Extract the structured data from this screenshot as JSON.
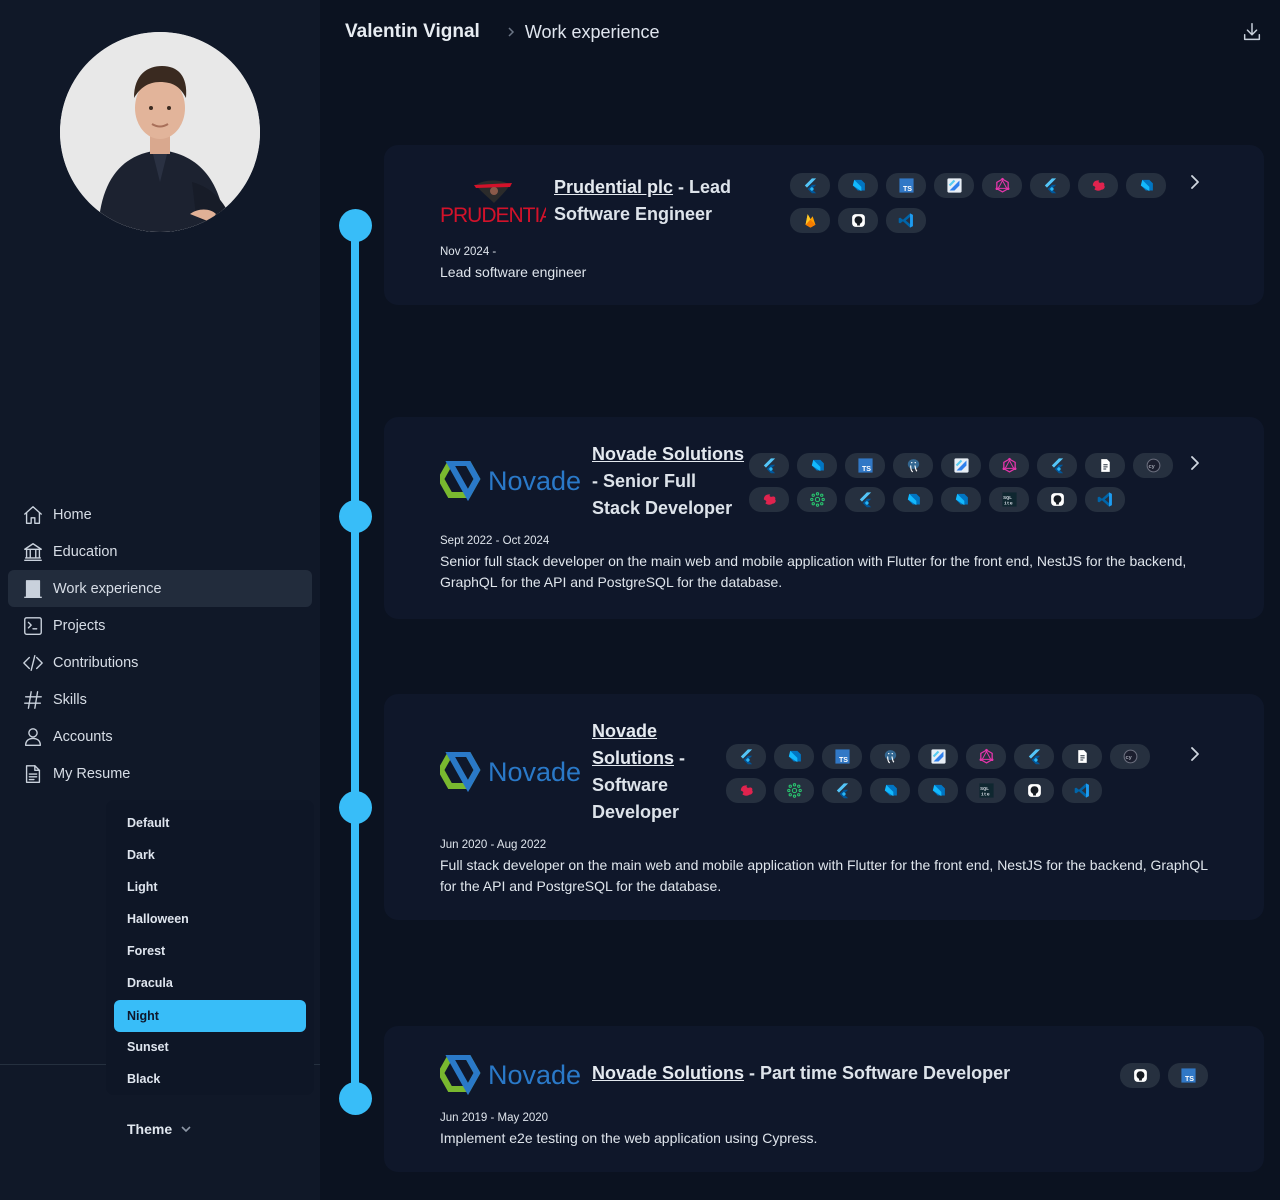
{
  "header": {
    "owner": "Valentin Vignal",
    "current": "Work experience"
  },
  "nav": [
    {
      "label": "Home",
      "icon": "home-icon"
    },
    {
      "label": "Education",
      "icon": "bank-icon"
    },
    {
      "label": "Work experience",
      "icon": "building-icon",
      "active": true
    },
    {
      "label": "Projects",
      "icon": "terminal-icon"
    },
    {
      "label": "Contributions",
      "icon": "code-icon"
    },
    {
      "label": "Skills",
      "icon": "hashtag-icon"
    },
    {
      "label": "Accounts",
      "icon": "person-icon"
    },
    {
      "label": "My Resume",
      "icon": "document-icon"
    }
  ],
  "theme": {
    "label": "Theme",
    "options": [
      "Default",
      "Dark",
      "Light",
      "Halloween",
      "Forest",
      "Dracula",
      "Night",
      "Sunset",
      "Black"
    ],
    "selected": "Night"
  },
  "experiences": [
    {
      "company": "Prudential plc",
      "role": " - Lead Software Engineer",
      "logo": "PRUDENTIAL",
      "dates": "Nov 2024 -",
      "description": "Lead software engineer",
      "technologies": [
        "flutter",
        "dart",
        "typescript",
        "flutter-test",
        "graphql",
        "flutter",
        "nestjs",
        "dart",
        "firebase",
        "github",
        "vscode"
      ]
    },
    {
      "company": "Novade Solutions",
      "role": " - Senior Full Stack Developer",
      "logo": "Novade",
      "dates": "Sept 2022 - Oct 2024",
      "description": "Senior full stack developer on the main web and mobile application with Flutter for the front end, NestJS for the backend, GraphQL for the API and PostgreSQL for the database.",
      "technologies": [
        "flutter",
        "dart",
        "typescript",
        "postgresql",
        "flutter-test",
        "graphql",
        "flutter",
        "document",
        "cypress",
        "nestjs",
        "openapi",
        "flutter",
        "dart",
        "dart",
        "sqlite",
        "github",
        "vscode"
      ]
    },
    {
      "company": "Novade Solutions",
      "role": " - Software Developer",
      "logo": "Novade",
      "dates": "Jun 2020 - Aug 2022",
      "description": "Full stack developer on the main web and mobile application with Flutter for the front end, NestJS for the backend, GraphQL for the API and PostgreSQL for the database.",
      "technologies": [
        "flutter",
        "dart",
        "typescript",
        "postgresql",
        "flutter-test",
        "graphql",
        "flutter",
        "document",
        "cypress",
        "nestjs",
        "openapi",
        "flutter",
        "dart",
        "dart",
        "sqlite",
        "github",
        "vscode"
      ]
    },
    {
      "company": "Novade Solutions",
      "role": " - Part time Software Developer",
      "logo": "Novade",
      "dates": "Jun 2019 - May 2020",
      "description": "Implement e2e testing on the web application using Cypress.",
      "technologies": [
        "github",
        "typescript"
      ]
    }
  ]
}
